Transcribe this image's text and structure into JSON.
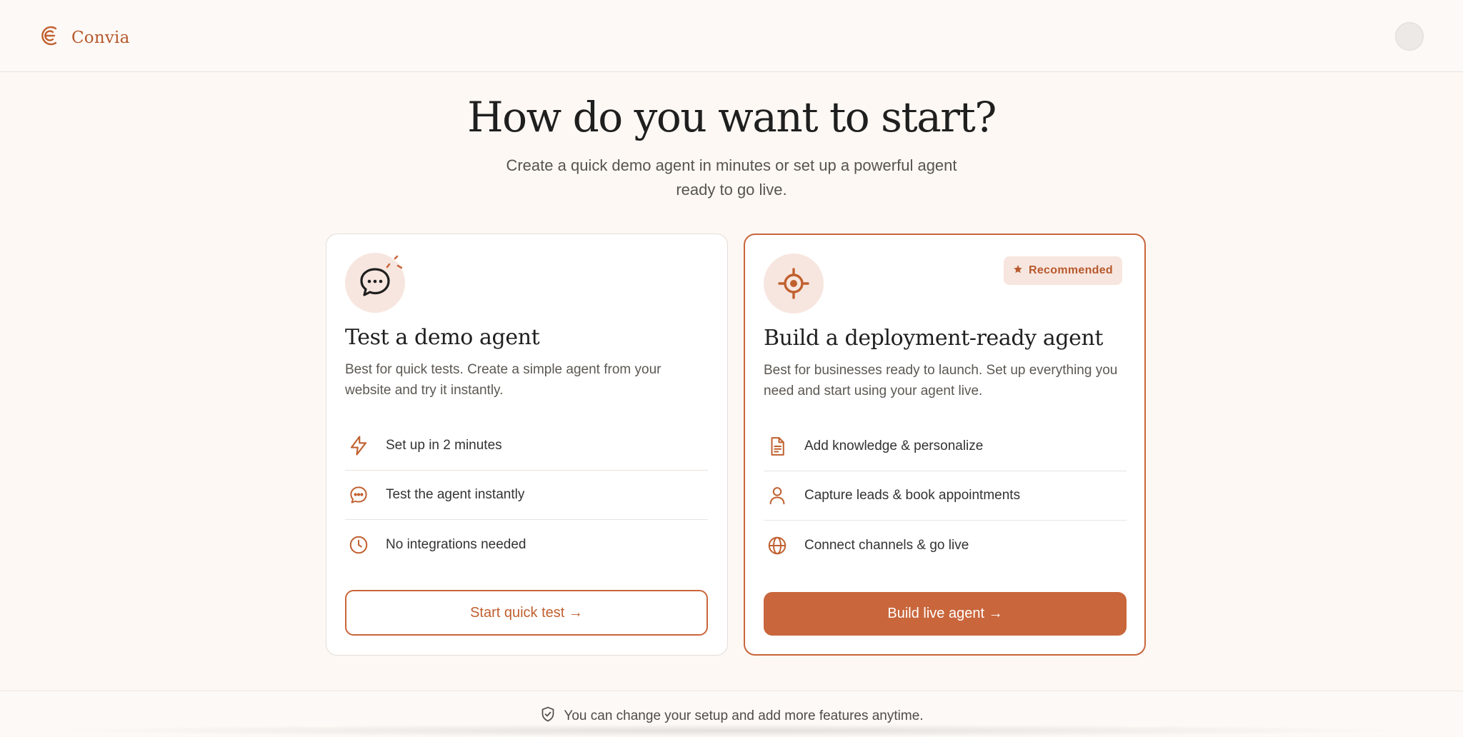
{
  "header": {
    "brand_name": "Convia",
    "brand_icon": "convia-logo-icon",
    "avatar_icon": "user-avatar"
  },
  "main": {
    "title": "How do you want to start?",
    "subtitle": "Create a quick demo agent in minutes or set up a powerful agent ready to go live."
  },
  "cards": {
    "demo": {
      "icon": "chat-bubble-icon",
      "title": "Test a demo agent",
      "description": "Best for quick tests. Create a simple agent from your website and try it instantly.",
      "features": [
        {
          "icon": "lightning-icon",
          "label": "Set up in 2 minutes"
        },
        {
          "icon": "chat-icon",
          "label": "Test the agent instantly"
        },
        {
          "icon": "clock-icon",
          "label": "No integrations needed"
        }
      ],
      "button_label": "Start quick test →"
    },
    "live": {
      "icon": "target-icon",
      "badge": "Recommended",
      "badge_icon": "star-icon",
      "title": "Build a deployment-ready agent",
      "description": "Best for businesses ready to launch. Set up everything you need and start using your agent live.",
      "features": [
        {
          "icon": "document-icon",
          "label": "Add knowledge & personalize"
        },
        {
          "icon": "person-icon",
          "label": "Capture leads & book appointments"
        },
        {
          "icon": "globe-icon",
          "label": "Connect channels & go live"
        }
      ],
      "button_label": "Build live agent →"
    }
  },
  "footer": {
    "icon": "shield-check-icon",
    "note": "You can change your setup and add more features anytime."
  },
  "colors": {
    "accent": "#c9653a",
    "background": "#fdf8f4",
    "accent_soft": "#f7e6df"
  }
}
